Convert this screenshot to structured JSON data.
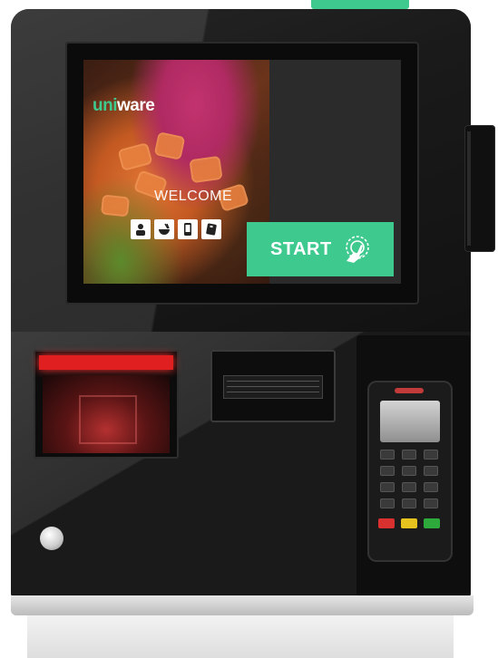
{
  "kiosk_screen": {
    "brand": {
      "prefix": "uni",
      "suffix": "ware"
    },
    "welcome_text": "WELCOME",
    "start_label": "START",
    "icons": [
      "person-icon",
      "food-bowl-icon",
      "mobile-phone-icon",
      "card-icon"
    ]
  },
  "colors": {
    "accent_green": "#3ec98f",
    "scanner_red": "#e02020",
    "shell_dark": "#141414"
  },
  "hardware": [
    "touchscreen",
    "side-card-reader",
    "barcode-scanner",
    "receipt-printer",
    "payment-terminal",
    "round-button"
  ]
}
